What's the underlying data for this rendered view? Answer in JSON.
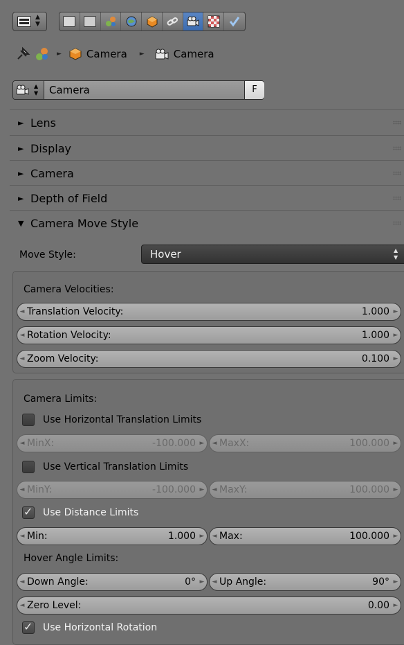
{
  "breadcrumb": {
    "object": "Camera",
    "data": "Camera"
  },
  "datablock": {
    "name": "Camera",
    "fake_user": "F"
  },
  "panels": {
    "lens": "Lens",
    "display": "Display",
    "camera": "Camera",
    "dof": "Depth of Field",
    "move_style": "Camera Move Style"
  },
  "move": {
    "label": "Move Style:",
    "value": "Hover"
  },
  "velocities": {
    "title": "Camera Velocities:",
    "translation": {
      "label": "Translation Velocity:",
      "value": "1.000"
    },
    "rotation": {
      "label": "Rotation Velocity:",
      "value": "1.000"
    },
    "zoom": {
      "label": "Zoom Velocity:",
      "value": "0.100"
    }
  },
  "limits": {
    "title": "Camera Limits:",
    "use_horizontal": "Use Horizontal Translation Limits",
    "minx": {
      "label": "MinX:",
      "value": "-100.000"
    },
    "maxx": {
      "label": "MaxX:",
      "value": "100.000"
    },
    "use_vertical": "Use Vertical Translation Limits",
    "miny": {
      "label": "MinY:",
      "value": "-100.000"
    },
    "maxy": {
      "label": "MaxY:",
      "value": "100.000"
    },
    "use_distance": "Use Distance Limits",
    "min": {
      "label": "Min:",
      "value": "1.000"
    },
    "max": {
      "label": "Max:",
      "value": "100.000"
    },
    "hover_title": "Hover Angle Limits:",
    "down": {
      "label": "Down Angle:",
      "value": "0°"
    },
    "up": {
      "label": "Up Angle:",
      "value": "90°"
    },
    "zero": {
      "label": "Zero Level:",
      "value": "0.00"
    },
    "use_hrot": "Use Horizontal Rotation"
  },
  "checkbox_state": {
    "horizontal": false,
    "vertical": false,
    "distance": true,
    "horizontal_rotation": true
  },
  "colors": {
    "background": "#727272",
    "accent": "#5680c2",
    "dropdown_bg": "#3c3c3c"
  }
}
